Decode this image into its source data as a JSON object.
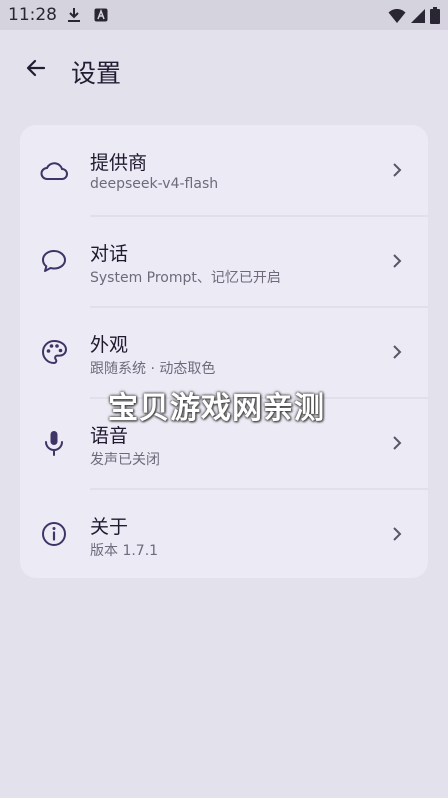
{
  "status_bar": {
    "time": "11:28",
    "icons_left": [
      "download-icon",
      "a-badge-icon"
    ],
    "icons_right": [
      "wifi-icon",
      "signal-icon",
      "battery-icon"
    ]
  },
  "app_bar": {
    "title": "设置",
    "back_icon": "arrow-back-icon"
  },
  "settings": {
    "items": [
      {
        "icon": "cloud-icon",
        "title": "提供商",
        "subtitle": "deepseek-v4-flash"
      },
      {
        "icon": "chat-bubble-icon",
        "title": "对话",
        "subtitle": "System Prompt、记忆已开启"
      },
      {
        "icon": "palette-icon",
        "title": "外观",
        "subtitle": "跟随系统 · 动态取色"
      },
      {
        "icon": "mic-icon",
        "title": "语音",
        "subtitle": "发声已关闭"
      },
      {
        "icon": "info-icon",
        "title": "关于",
        "subtitle": "版本 1.7.1"
      }
    ]
  },
  "watermark": "宝贝游戏网亲测",
  "colors": {
    "background": "#e3e1eb",
    "card": "#eceaf4",
    "accent_icon": "#3f3466",
    "subtitle": "#6e6a7c"
  }
}
